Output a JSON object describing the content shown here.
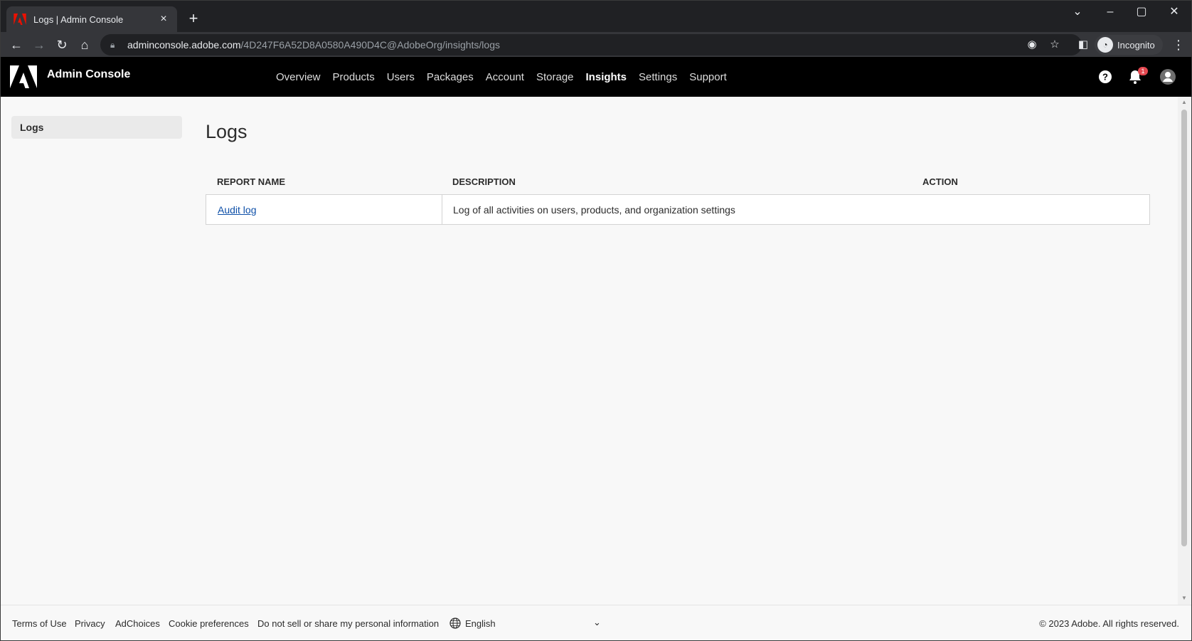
{
  "browser": {
    "tab_title": "Logs | Admin Console",
    "tab_close": "×",
    "new_tab": "+",
    "url_host": "adminconsole.adobe.com",
    "url_path": "/4D247F6A52D8A0580A490D4C@AdobeOrg/insights/logs",
    "incognito_label": "Incognito"
  },
  "app": {
    "name": "Admin Console",
    "nav": [
      "Overview",
      "Products",
      "Users",
      "Packages",
      "Account",
      "Storage",
      "Insights",
      "Settings",
      "Support"
    ],
    "active_nav": "Insights",
    "notification_count": "1"
  },
  "sidebar": {
    "items": [
      {
        "label": "Logs"
      }
    ]
  },
  "main": {
    "title": "Logs",
    "table": {
      "headers": [
        "REPORT NAME",
        "DESCRIPTION",
        "ACTION"
      ],
      "rows": [
        {
          "report_name": "Audit log",
          "description": "Log of all activities on users, products, and organization settings",
          "action": ""
        }
      ]
    }
  },
  "footer": {
    "links": [
      "Terms of Use",
      "Privacy",
      "AdChoices",
      "Cookie preferences",
      "Do not sell or share my personal information"
    ],
    "language": "English",
    "copyright": "© 2023 Adobe. All rights reserved."
  },
  "colors": {
    "appbar": "#000000",
    "link": "#0d4fa8",
    "badge": "#e34850",
    "adobe_red": "#eb1000"
  }
}
